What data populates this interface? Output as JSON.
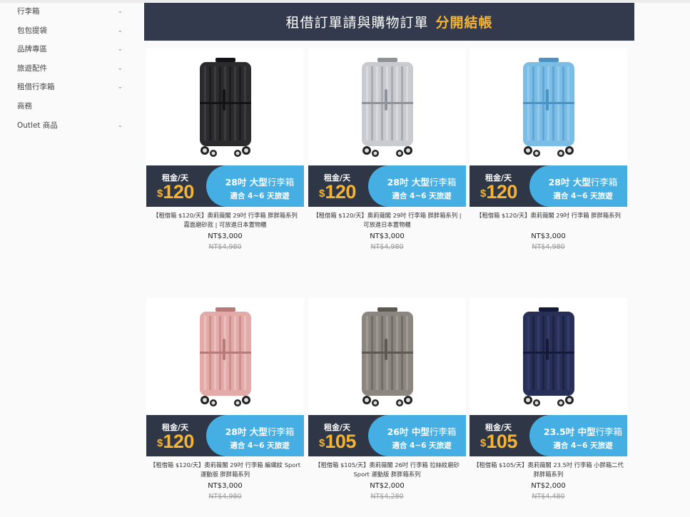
{
  "sidebar": {
    "items": [
      {
        "label": "行李箱",
        "has_children": true
      },
      {
        "label": "包包提袋",
        "has_children": true
      },
      {
        "label": "品牌專區",
        "has_children": true
      },
      {
        "label": "旅遊配件",
        "has_children": true
      },
      {
        "label": "租借行李箱",
        "has_children": true
      },
      {
        "label": "商務",
        "has_children": false
      },
      {
        "label": "Outlet 商品",
        "has_children": true
      }
    ],
    "chevron_icon": "chevron-down-icon"
  },
  "banner": {
    "text_white": "租借訂單請與購物訂單",
    "text_highlight": "分開結帳"
  },
  "colors": {
    "banner_bg": "#333a4d",
    "promo_bg": "#2f3646",
    "pill_bg": "#45aee3",
    "highlight": "#f5b533"
  },
  "products": [
    {
      "rent_label": "租金/天",
      "currency": "$",
      "price": "120",
      "size": "28吋",
      "size_type": "大型",
      "suffix": "行李箱",
      "trip": "適合 4~6 天旅遊",
      "name": "【租借箱 $120/天】奧莉薇閣 29吋 行李箱 胖胖箱系列 霧面磨砂款 | 可放進日本置物櫃",
      "price_now": "NT$3,000",
      "price_orig": "NT$4,980",
      "color": "black"
    },
    {
      "rent_label": "租金/天",
      "currency": "$",
      "price": "120",
      "size": "28吋",
      "size_type": "大型",
      "suffix": "行李箱",
      "trip": "適合 4~6 天旅遊",
      "name": "【租借箱 $120/天】奧莉薇閣 29吋 行李箱 胖胖箱系列 | 可放進日本置物櫃",
      "price_now": "NT$3,000",
      "price_orig": "NT$4,980",
      "color": "silver"
    },
    {
      "rent_label": "租金/天",
      "currency": "$",
      "price": "120",
      "size": "28吋",
      "size_type": "大型",
      "suffix": "行李箱",
      "trip": "適合 4~6 天旅遊",
      "name": "【租借箱 $120/天】奧莉薇閣 29吋 行李箱 胖胖箱系列",
      "price_now": "NT$3,000",
      "price_orig": "NT$4,980",
      "color": "lightblue"
    },
    {
      "rent_label": "租金/天",
      "currency": "$",
      "price": "120",
      "size": "28吋",
      "size_type": "大型",
      "suffix": "行李箱",
      "trip": "適合 4~6 天旅遊",
      "name": "【租借箱 $120/天】奧莉薇閣 29吋 行李箱 編織紋 Sport 運動版 胖胖箱系列",
      "price_now": "NT$3,000",
      "price_orig": "NT$4,980",
      "color": "rosegold"
    },
    {
      "rent_label": "租金/天",
      "currency": "$",
      "price": "105",
      "size": "26吋",
      "size_type": "中型",
      "suffix": "行李箱",
      "trip": "適合 4~6 天旅遊",
      "name": "【租借箱 $105/天】奧莉薇閣 26吋 行李箱 拉絲紋磨砂 Sport 運動版 胖胖箱系列",
      "price_now": "NT$2,000",
      "price_orig": "NT$4,280",
      "color": "graygold"
    },
    {
      "rent_label": "租金/天",
      "currency": "$",
      "price": "105",
      "size": "23.5吋",
      "size_type": "中型",
      "suffix": "行李箱",
      "trip": "適合 4~6 天旅遊",
      "name": "【租借箱 $105/天】奧莉薇閣 23.5吋 行李箱 小胖箱二代 胖胖箱系列",
      "price_now": "NT$2,000",
      "price_orig": "NT$4,480",
      "color": "navy"
    }
  ]
}
